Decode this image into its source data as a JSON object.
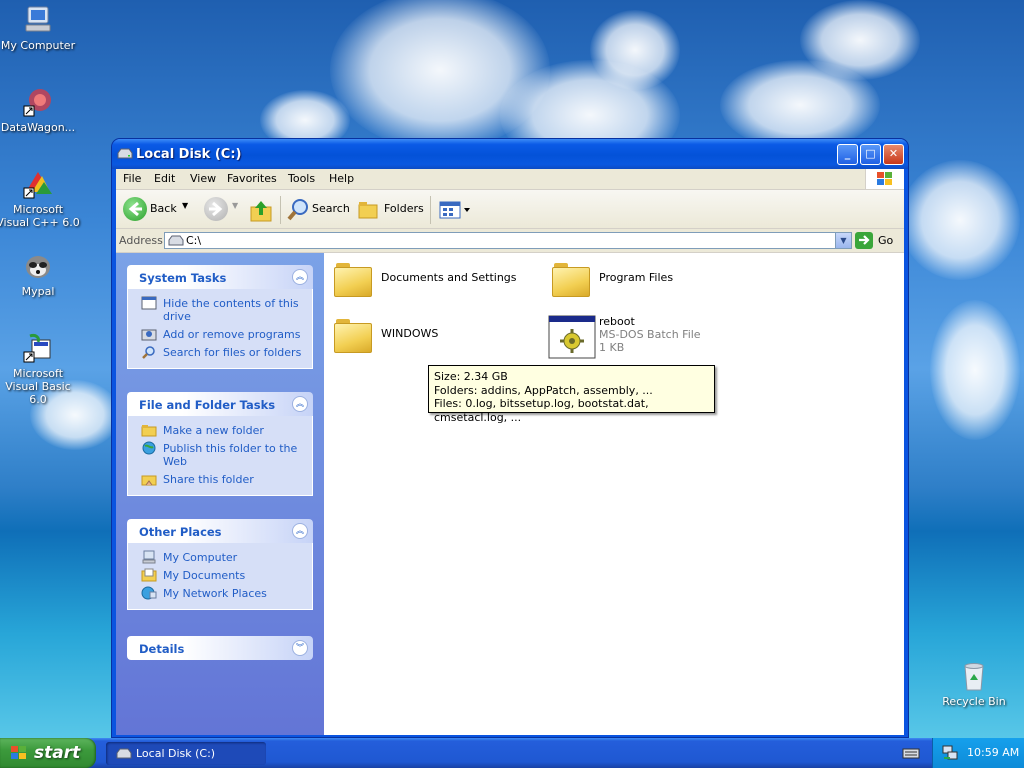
{
  "desktop": {
    "icons": [
      {
        "label": "My Computer",
        "icon": "my-computer-icon"
      },
      {
        "label": "DataWagon...",
        "icon": "datawagon-shortcut-icon"
      },
      {
        "label": "Microsoft Visual C++ 6.0",
        "icon": "visual-cpp-icon"
      },
      {
        "label": "Mypal",
        "icon": "mypal-icon"
      },
      {
        "label": "Microsoft Visual Basic 6.0",
        "icon": "visual-basic-icon"
      },
      {
        "label": "Recycle Bin",
        "icon": "recycle-bin-icon"
      }
    ]
  },
  "window": {
    "title": "Local Disk (C:)",
    "menu": [
      "File",
      "Edit",
      "View",
      "Favorites",
      "Tools",
      "Help"
    ],
    "toolbar": {
      "back": "Back",
      "search": "Search",
      "folders": "Folders"
    },
    "address": {
      "label": "Address",
      "value": "C:\\",
      "go": "Go"
    }
  },
  "tasks": {
    "system": {
      "title": "System Tasks",
      "items": [
        "Hide the contents of this drive",
        "Add or remove programs",
        "Search for files or folders"
      ]
    },
    "file_folder": {
      "title": "File and Folder Tasks",
      "items": [
        "Make a new folder",
        "Publish this folder to the Web",
        "Share this folder"
      ]
    },
    "other_places": {
      "title": "Other Places",
      "items": [
        "My Computer",
        "My Documents",
        "My Network Places"
      ]
    },
    "details": {
      "title": "Details"
    }
  },
  "files": [
    {
      "name": "Documents and Settings",
      "type": "folder"
    },
    {
      "name": "Program Files",
      "type": "folder"
    },
    {
      "name": "WINDOWS",
      "type": "folder"
    },
    {
      "name": "reboot",
      "type": "batch",
      "desc": "MS-DOS Batch File",
      "size": "1 KB"
    }
  ],
  "tooltip": {
    "size": "Size: 2.34 GB",
    "folders": "Folders: addins, AppPatch, assembly, ...",
    "files": "Files: 0.log, bitssetup.log, bootstat.dat, cmsetacl.log, ..."
  },
  "taskbar": {
    "start": "start",
    "task": "Local Disk (C:)",
    "clock": "10:59 AM"
  },
  "colors": {
    "link": "#215dc6",
    "title_bar": "#0a58e0",
    "task_pane": "#7ba2e7"
  }
}
